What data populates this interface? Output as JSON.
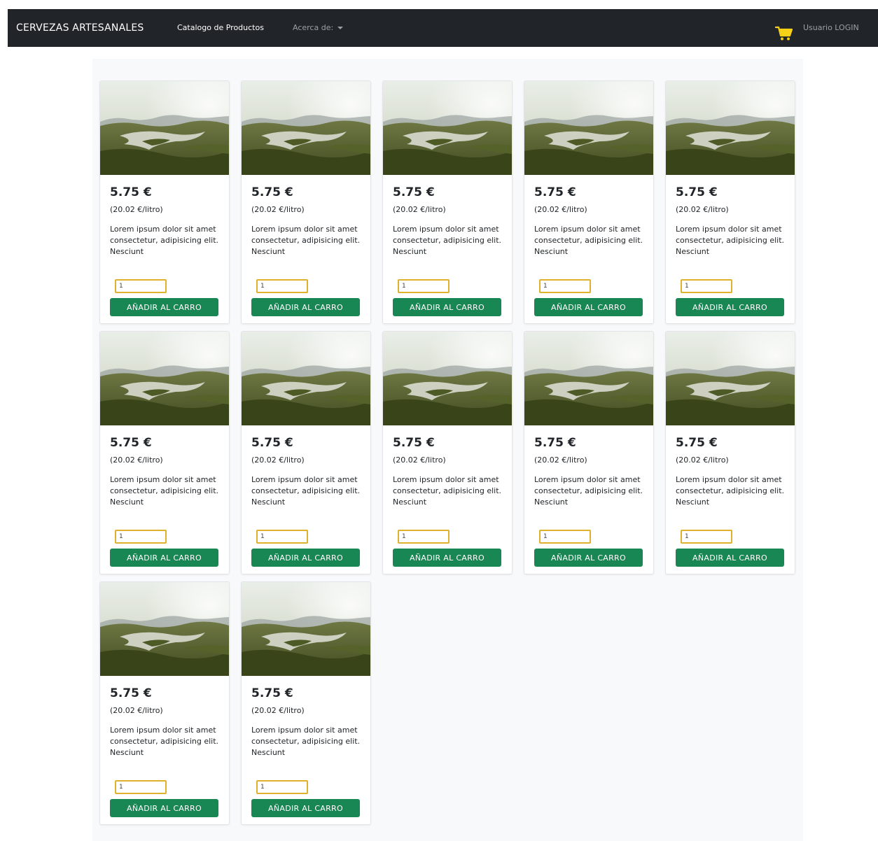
{
  "navbar": {
    "brand": "CERVEZAS ARTESANALES",
    "catalog_link": "Catalogo de Productos",
    "about_link": "Acerca de:",
    "user_link": "Usuario LOGIN",
    "cart_icon": "shopping-cart-icon",
    "cart_color": "#f7d117"
  },
  "products": [
    {
      "price": "5.75 €",
      "price_per_liter": "(20.02 €/litro)",
      "description": "Lorem ipsum dolor sit amet consectetur, adipisicing elit. Nesciunt",
      "quantity": "1",
      "button_label": "AÑADIR AL CARRO"
    },
    {
      "price": "5.75 €",
      "price_per_liter": "(20.02 €/litro)",
      "description": "Lorem ipsum dolor sit amet consectetur, adipisicing elit. Nesciunt",
      "quantity": "1",
      "button_label": "AÑADIR AL CARRO"
    },
    {
      "price": "5.75 €",
      "price_per_liter": "(20.02 €/litro)",
      "description": "Lorem ipsum dolor sit amet consectetur, adipisicing elit. Nesciunt",
      "quantity": "1",
      "button_label": "AÑADIR AL CARRO"
    },
    {
      "price": "5.75 €",
      "price_per_liter": "(20.02 €/litro)",
      "description": "Lorem ipsum dolor sit amet consectetur, adipisicing elit. Nesciunt",
      "quantity": "1",
      "button_label": "AÑADIR AL CARRO"
    },
    {
      "price": "5.75 €",
      "price_per_liter": "(20.02 €/litro)",
      "description": "Lorem ipsum dolor sit amet consectetur, adipisicing elit. Nesciunt",
      "quantity": "1",
      "button_label": "AÑADIR AL CARRO"
    },
    {
      "price": "5.75 €",
      "price_per_liter": "(20.02 €/litro)",
      "description": "Lorem ipsum dolor sit amet consectetur, adipisicing elit. Nesciunt",
      "quantity": "1",
      "button_label": "AÑADIR AL CARRO"
    },
    {
      "price": "5.75 €",
      "price_per_liter": "(20.02 €/litro)",
      "description": "Lorem ipsum dolor sit amet consectetur, adipisicing elit. Nesciunt",
      "quantity": "1",
      "button_label": "AÑADIR AL CARRO"
    },
    {
      "price": "5.75 €",
      "price_per_liter": "(20.02 €/litro)",
      "description": "Lorem ipsum dolor sit amet consectetur, adipisicing elit. Nesciunt",
      "quantity": "1",
      "button_label": "AÑADIR AL CARRO"
    },
    {
      "price": "5.75 €",
      "price_per_liter": "(20.02 €/litro)",
      "description": "Lorem ipsum dolor sit amet consectetur, adipisicing elit. Nesciunt",
      "quantity": "1",
      "button_label": "AÑADIR AL CARRO"
    },
    {
      "price": "5.75 €",
      "price_per_liter": "(20.02 €/litro)",
      "description": "Lorem ipsum dolor sit amet consectetur, adipisicing elit. Nesciunt",
      "quantity": "1",
      "button_label": "AÑADIR AL CARRO"
    },
    {
      "price": "5.75 €",
      "price_per_liter": "(20.02 €/litro)",
      "description": "Lorem ipsum dolor sit amet consectetur, adipisicing elit. Nesciunt",
      "quantity": "1",
      "button_label": "AÑADIR AL CARRO"
    },
    {
      "price": "5.75 €",
      "price_per_liter": "(20.02 €/litro)",
      "description": "Lorem ipsum dolor sit amet consectetur, adipisicing elit. Nesciunt",
      "quantity": "1",
      "button_label": "AÑADIR AL CARRO"
    }
  ],
  "colors": {
    "navbar_bg": "#212529",
    "button_green": "#198754",
    "input_border": "#e0b12e",
    "content_bg": "#f8f9fa"
  }
}
